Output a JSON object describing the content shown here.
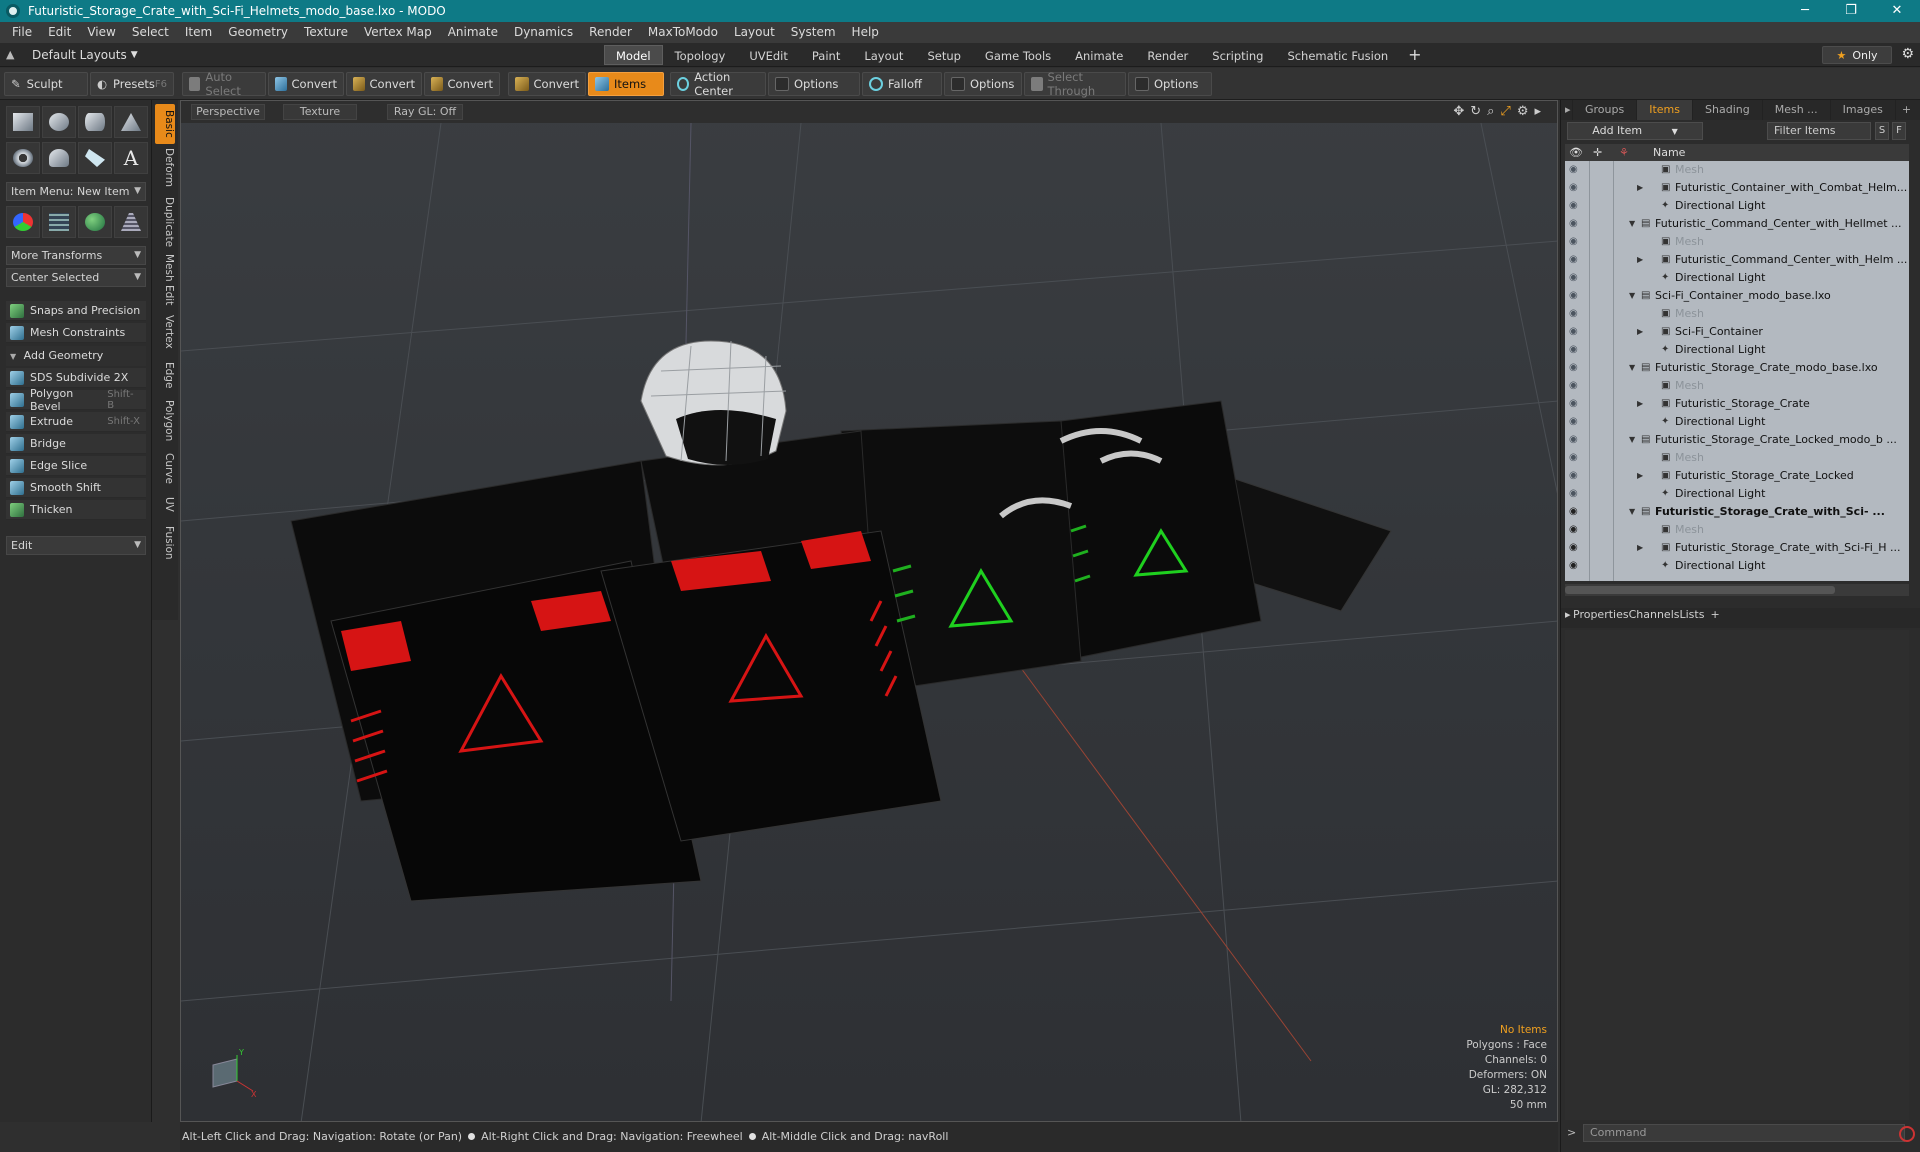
{
  "window": {
    "title": "Futuristic_Storage_Crate_with_Sci-Fi_Helmets_modo_base.lxo - MODO",
    "buttons": [
      "─",
      "❐",
      "✕"
    ]
  },
  "menu": [
    "File",
    "Edit",
    "View",
    "Select",
    "Item",
    "Geometry",
    "Texture",
    "Vertex Map",
    "Animate",
    "Dynamics",
    "Render",
    "MaxToModo",
    "Layout",
    "System",
    "Help"
  ],
  "layout_selector": "Default Layouts",
  "layout_tabs": [
    "Model",
    "Topology",
    "UVEdit",
    "Paint",
    "Layout",
    "Setup",
    "Game Tools",
    "Animate",
    "Render",
    "Scripting",
    "Schematic Fusion"
  ],
  "active_layout_tab": "Model",
  "only_label": "Only",
  "toolbar": {
    "sculpt": "Sculpt",
    "presets": "Presets",
    "presets_key": "F6",
    "auto_select": "Auto Select",
    "convert": "Convert",
    "items": "Items",
    "action_center": "Action Center",
    "options": "Options",
    "falloff": "Falloff",
    "select_through": "Select Through"
  },
  "left_panel": {
    "item_menu": "Item Menu: New Item",
    "more_transforms": "More Transforms",
    "center_selected": "Center Selected",
    "snaps": "Snaps and Precision",
    "mesh_constraints": "Mesh Constraints",
    "add_geometry": "Add Geometry",
    "tools": [
      {
        "label": "SDS Subdivide 2X",
        "shortcut": ""
      },
      {
        "label": "Polygon Bevel",
        "shortcut": "Shift-B"
      },
      {
        "label": "Extrude",
        "shortcut": "Shift-X"
      },
      {
        "label": "Bridge",
        "shortcut": ""
      },
      {
        "label": "Edge Slice",
        "shortcut": ""
      },
      {
        "label": "Smooth Shift",
        "shortcut": ""
      },
      {
        "label": "Thicken",
        "shortcut": ""
      }
    ],
    "edit": "Edit",
    "vertical_tabs": [
      "Basic",
      "Deform",
      "Duplicate",
      "Mesh Edit",
      "Vertex",
      "Edge",
      "Polygon",
      "Curve",
      "UV",
      "Fusion"
    ]
  },
  "viewport": {
    "tabs": [
      "Perspective",
      "Texture",
      "Ray GL: Off"
    ],
    "info": {
      "no_items": "No Items",
      "polygons": "Polygons : Face",
      "channels": "Channels: 0",
      "deformers": "Deformers: ON",
      "gl": "GL: 282,312",
      "focal": "50 mm"
    },
    "axis_y": "Y",
    "axis_x": "X"
  },
  "status": [
    "Alt-Left Click and Drag: Navigation: Rotate (or Pan)",
    "Alt-Right Click and Drag: Navigation: Freewheel",
    "Alt-Middle Click and Drag: navRoll"
  ],
  "right_panel": {
    "tabs": [
      "Groups",
      "Items",
      "Shading",
      "Mesh ...",
      "Images"
    ],
    "active_tab": "Items",
    "add_item": "Add Item",
    "filter": "Filter Items",
    "s_btn": "S",
    "f_btn": "F",
    "name_col": "Name",
    "tree": [
      {
        "label": "Mesh",
        "kind": "ghost",
        "indent": 2
      },
      {
        "label": "Futuristic_Container_with_Combat_Helm...",
        "kind": "item",
        "indent": 2
      },
      {
        "label": "Directional Light",
        "kind": "item",
        "indent": 2
      },
      {
        "label": "Futuristic_Command_Center_with_Hellmet ...",
        "kind": "group",
        "indent": 1
      },
      {
        "label": "Mesh",
        "kind": "ghost",
        "indent": 2
      },
      {
        "label": "Futuristic_Command_Center_with_Helm ...",
        "kind": "item",
        "indent": 2
      },
      {
        "label": "Directional Light",
        "kind": "item",
        "indent": 2
      },
      {
        "label": "Sci-Fi_Container_modo_base.lxo",
        "kind": "group",
        "indent": 1
      },
      {
        "label": "Mesh",
        "kind": "ghost",
        "indent": 2
      },
      {
        "label": "Sci-Fi_Container",
        "kind": "item",
        "indent": 2
      },
      {
        "label": "Directional Light",
        "kind": "item",
        "indent": 2
      },
      {
        "label": "Futuristic_Storage_Crate_modo_base.lxo",
        "kind": "group",
        "indent": 1
      },
      {
        "label": "Mesh",
        "kind": "ghost",
        "indent": 2
      },
      {
        "label": "Futuristic_Storage_Crate",
        "kind": "item",
        "indent": 2
      },
      {
        "label": "Directional Light",
        "kind": "item",
        "indent": 2
      },
      {
        "label": "Futuristic_Storage_Crate_Locked_modo_b ...",
        "kind": "group",
        "indent": 1
      },
      {
        "label": "Mesh",
        "kind": "ghost",
        "indent": 2
      },
      {
        "label": "Futuristic_Storage_Crate_Locked",
        "kind": "item",
        "indent": 2
      },
      {
        "label": "Directional Light",
        "kind": "item",
        "indent": 2
      },
      {
        "label": "Futuristic_Storage_Crate_with_Sci- ...",
        "kind": "bold",
        "indent": 1
      },
      {
        "label": "Mesh",
        "kind": "ghost",
        "indent": 2
      },
      {
        "label": "Futuristic_Storage_Crate_with_Sci-Fi_H ...",
        "kind": "item",
        "indent": 2
      },
      {
        "label": "Directional Light",
        "kind": "item",
        "indent": 2
      }
    ],
    "prop_tabs": [
      "Properties",
      "Channels",
      "Lists"
    ],
    "active_prop_tab": "Properties",
    "command_placeholder": "Command"
  }
}
